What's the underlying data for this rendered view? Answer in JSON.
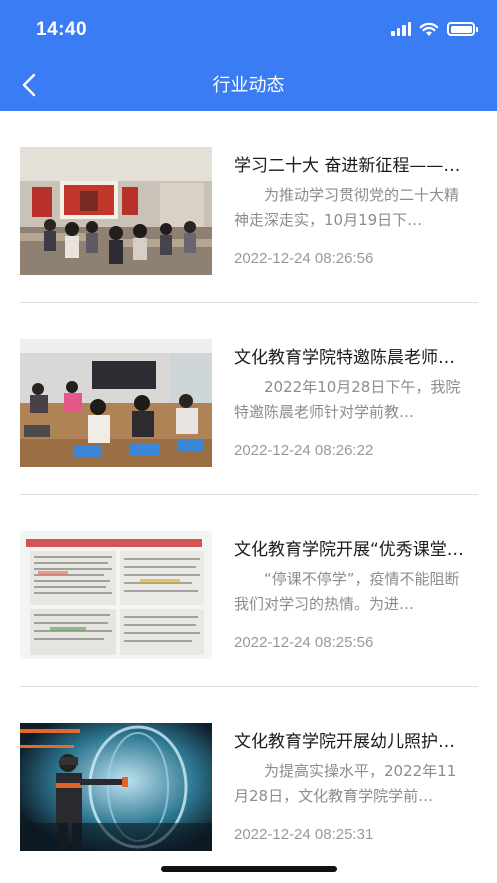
{
  "status_bar": {
    "time": "14:40"
  },
  "nav": {
    "title": "行业动态",
    "back_icon": "chevron-left-icon"
  },
  "colors": {
    "header_bg": "#3a7cf3",
    "title_text": "#1a1a1a",
    "summary_text": "#8c8c8c",
    "date_text": "#999999"
  },
  "items": [
    {
      "title": "学习二十大 奋进新征程——…",
      "summary": "为推动学习贯彻党的二十大精神走深走实，10月19日下…",
      "date": "2022-12-24 08:26:56",
      "image": "classroom-meeting-photo"
    },
    {
      "title": "文化教育学院特邀陈晨老师…",
      "summary": "2022年10月28日下午，我院特邀陈晨老师针对学前教…",
      "date": "2022-12-24 08:26:22",
      "image": "students-classroom-photo"
    },
    {
      "title": "文化教育学院开展“优秀课堂…",
      "summary": "“停课不停学”，疫情不能阻断我们对学习的热情。为进…",
      "date": "2022-12-24 08:25:56",
      "image": "study-notes-photo"
    },
    {
      "title": "文化教育学院开展幼儿照护…",
      "summary": "为提高实操水平，2022年11月28日，文化教育学院学前…",
      "date": "2022-12-24 08:25:31",
      "image": "vr-training-photo"
    }
  ]
}
